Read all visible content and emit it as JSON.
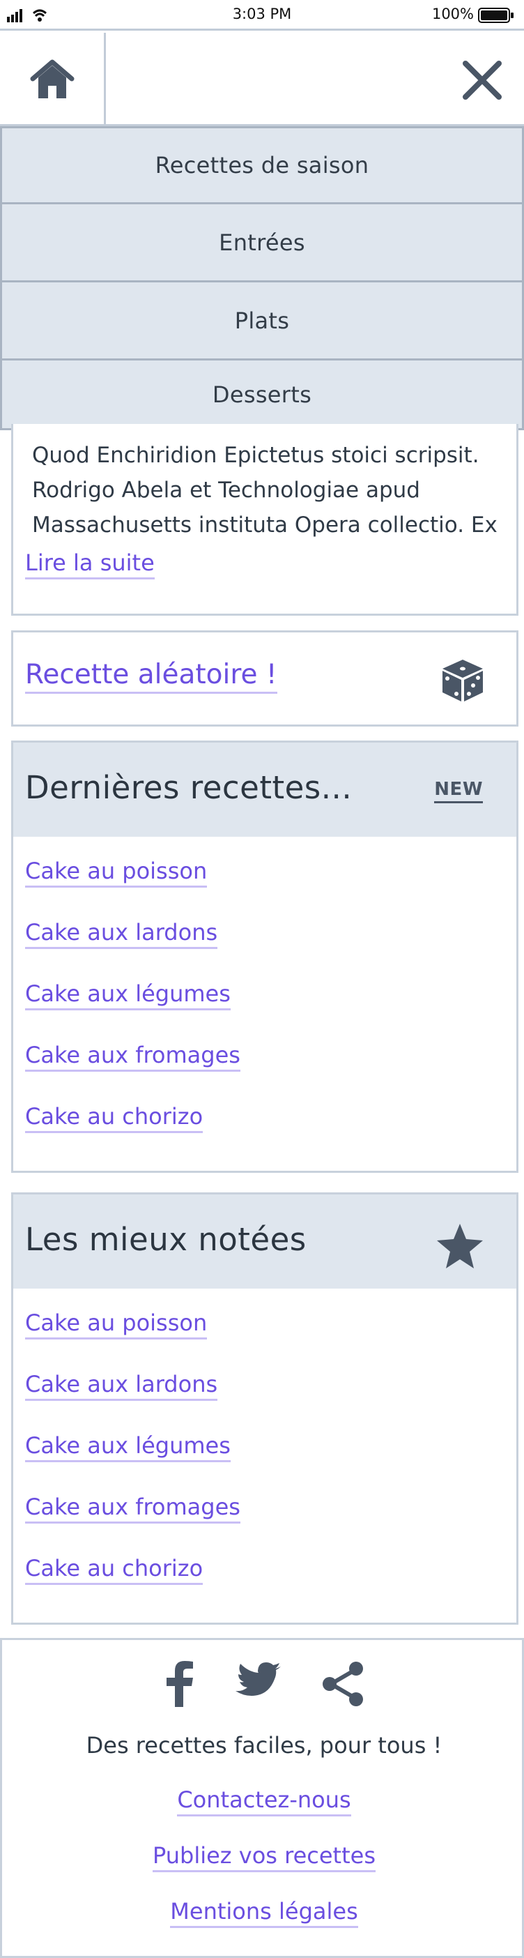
{
  "status": {
    "time": "3:03 PM",
    "battery": "100%"
  },
  "header": {
    "home_icon": "home-icon",
    "close_icon": "close-icon"
  },
  "menu": {
    "items": [
      {
        "label": "Recettes de saison"
      },
      {
        "label": "Entrées"
      },
      {
        "label": "Plats"
      },
      {
        "label": "Desserts"
      }
    ]
  },
  "excerpt": {
    "text": "Quod Enchiridion Epictetus stoici scripsit. Rodrigo Abela et Technologiae apud Massachusetts instituta Opera collectio. Ex",
    "read_more": "Lire la suite"
  },
  "random": {
    "label": "Recette aléatoire !",
    "icon": "dice-icon"
  },
  "latest": {
    "title": "Dernières recettes...",
    "badge": "NEW",
    "items": [
      {
        "label": "Cake au poisson"
      },
      {
        "label": "Cake aux lardons"
      },
      {
        "label": "Cake aux légumes"
      },
      {
        "label": "Cake aux fromages"
      },
      {
        "label": "Cake au chorizo"
      }
    ]
  },
  "best": {
    "title": "Les mieux notées",
    "icon": "star-icon",
    "items": [
      {
        "label": "Cake au poisson"
      },
      {
        "label": "Cake aux lardons"
      },
      {
        "label": "Cake aux légumes"
      },
      {
        "label": "Cake aux fromages"
      },
      {
        "label": "Cake au chorizo"
      }
    ]
  },
  "footer": {
    "social_icons": [
      "facebook-icon",
      "twitter-icon",
      "share-icon"
    ],
    "tagline": "Des recettes faciles, pour tous !",
    "links": [
      {
        "label": "Contactez-nous"
      },
      {
        "label": "Publiez vos recettes"
      },
      {
        "label": "Mentions légales"
      }
    ]
  },
  "colors": {
    "accent_link": "#6a4ee0",
    "panel": "#dfe6ee",
    "border": "#c8d1dc",
    "icon": "#4a5666"
  }
}
